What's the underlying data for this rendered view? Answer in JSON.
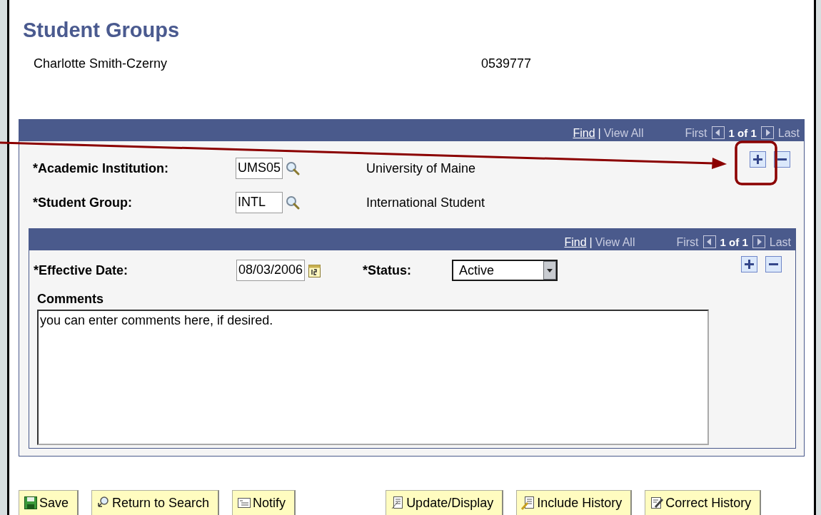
{
  "page": {
    "title": "Student Groups",
    "student_name": "Charlotte Smith-Czerny",
    "student_id": "0539777"
  },
  "outer_grid": {
    "nav": {
      "find": "Find",
      "separator": "|",
      "view_all": "View All",
      "first": "First",
      "count": "1 of 1",
      "last": "Last"
    },
    "fields": [
      {
        "label": "*Academic Institution:",
        "value": "UMS05",
        "description": "University of Maine"
      },
      {
        "label": "*Student Group:",
        "value": "INTL",
        "description": "International Student"
      }
    ]
  },
  "inner_grid": {
    "nav": {
      "find": "Find",
      "separator": "|",
      "view_all": "View All",
      "first": "First",
      "count": "1 of 1",
      "last": "Last"
    },
    "effective_date": {
      "label": "*Effective Date:",
      "value": "08/03/2006"
    },
    "status": {
      "label": "*Status:",
      "value": "Active"
    },
    "comments": {
      "label": "Comments",
      "value": "you can enter comments here, if desired."
    }
  },
  "buttons": [
    {
      "kind": "save",
      "label": "Save"
    },
    {
      "kind": "search",
      "label": "Return to Search"
    },
    {
      "kind": "notify",
      "label": "Notify"
    },
    {
      "kind": "update",
      "label": "Update/Display"
    },
    {
      "kind": "history",
      "label": "Include History"
    },
    {
      "kind": "correct",
      "label": "Correct History"
    }
  ],
  "annotation": {
    "arrow": true,
    "highlight": true
  }
}
